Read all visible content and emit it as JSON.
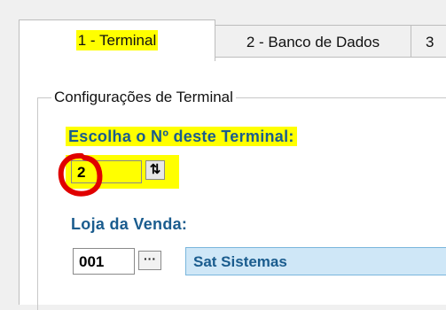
{
  "tabs": [
    {
      "label": "1 - Terminal"
    },
    {
      "label": "2 - Banco de Dados"
    },
    {
      "label": "3"
    }
  ],
  "group": {
    "title": "Configurações de Terminal"
  },
  "terminal": {
    "label": "Escolha o Nº deste Terminal:",
    "value": "2"
  },
  "store": {
    "label": "Loja da Venda:",
    "code": "001",
    "lookup_label": "···",
    "name": "Sat Sistemas"
  },
  "colors": {
    "highlight": "#ffff00",
    "annotation": "#e00000",
    "label_blue": "#1a5c8e",
    "readonly_bg": "#cfe7f7"
  },
  "icons": {
    "spin": "up-down-arrows-icon"
  }
}
